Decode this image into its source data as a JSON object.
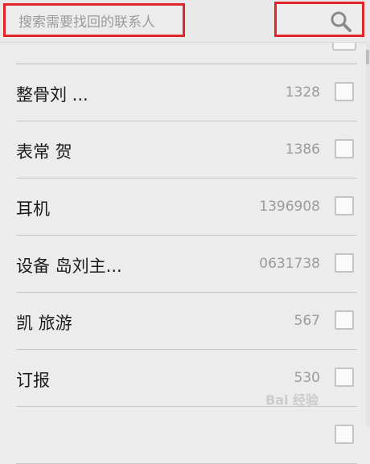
{
  "search": {
    "placeholder": "搜索需要找回的联系人"
  },
  "contacts": [
    {
      "name": "整骨刘 ...",
      "phone": "1328"
    },
    {
      "name": "表常 贺",
      "phone": "1386"
    },
    {
      "name": "耳机",
      "phone": "1396908"
    },
    {
      "name": "设备 岛刘主...",
      "phone": "0631738"
    },
    {
      "name": "凯 旅游",
      "phone": "567"
    },
    {
      "name": "订报",
      "phone": "530"
    },
    {
      "name": "",
      "phone": ""
    }
  ],
  "watermark": "Bai 经验",
  "colors": {
    "highlight": "#e0262b",
    "background": "#ececec",
    "placeholder": "#9a9a9a",
    "phone": "#9b9b9b"
  },
  "icons": {
    "search": "search-icon"
  }
}
